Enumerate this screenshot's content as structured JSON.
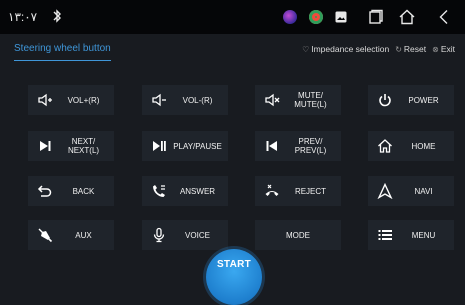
{
  "status_bar": {
    "time": "۱۳:۰۷",
    "bluetooth_icon": "bluetooth-icon",
    "app_icons": [
      "app-icon-purple",
      "app-icon-green",
      "image-icon"
    ],
    "nav_icons": [
      "recents-icon",
      "home-icon",
      "back-icon"
    ]
  },
  "header": {
    "active_tab": "Steering wheel button",
    "actions": {
      "impedance": "Impedance selection",
      "reset": "Reset",
      "exit": "Exit"
    }
  },
  "buttons": [
    {
      "id": "vol-up",
      "label": "VOL+(R)",
      "icon": "volume-up-icon"
    },
    {
      "id": "vol-down",
      "label": "VOL-(R)",
      "icon": "volume-down-icon"
    },
    {
      "id": "mute",
      "label": "MUTE/\nMUTE(L)",
      "icon": "mute-icon"
    },
    {
      "id": "power",
      "label": "POWER",
      "icon": "power-icon"
    },
    {
      "id": "next",
      "label": "NEXT/\nNEXT(L)",
      "icon": "next-icon"
    },
    {
      "id": "play-pause",
      "label": "PLAY/PAUSE",
      "icon": "play-pause-icon"
    },
    {
      "id": "prev",
      "label": "PREV/\nPREV(L)",
      "icon": "prev-icon"
    },
    {
      "id": "home",
      "label": "HOME",
      "icon": "home-icon"
    },
    {
      "id": "back",
      "label": "BACK",
      "icon": "back-arrow-icon"
    },
    {
      "id": "answer",
      "label": "ANSWER",
      "icon": "answer-call-icon"
    },
    {
      "id": "reject",
      "label": "REJECT",
      "icon": "reject-call-icon"
    },
    {
      "id": "navi",
      "label": "NAVI",
      "icon": "navigation-icon"
    },
    {
      "id": "aux",
      "label": "AUX",
      "icon": "aux-plug-icon"
    },
    {
      "id": "voice",
      "label": "VOICE",
      "icon": "microphone-icon"
    },
    {
      "id": "mode",
      "label": "MODE",
      "icon": ""
    },
    {
      "id": "menu",
      "label": "MENU",
      "icon": "menu-icon"
    }
  ],
  "start_button": "START",
  "colors": {
    "background": "#181b20",
    "status_bar": "#050608",
    "button": "#1f242b",
    "accent": "#3f96d8",
    "start": "#1e7fce"
  }
}
